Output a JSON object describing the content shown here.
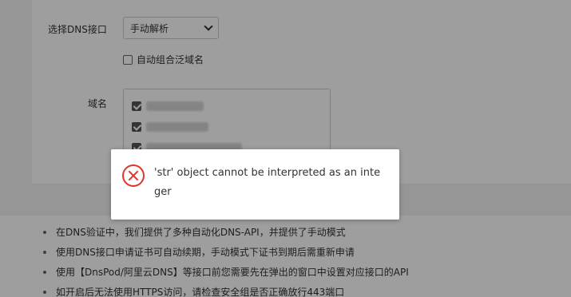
{
  "form": {
    "dns_label": "选择DNS接口",
    "dns_selected": "手动解析",
    "wildcard_label": "自动组合泛域名",
    "domain_label": "域名",
    "domains": [
      {
        "checked": true
      },
      {
        "checked": true
      },
      {
        "checked": true
      }
    ]
  },
  "tips": [
    "在DNS验证中，我们提供了多种自动化DNS-API，并提供了手动模式",
    "使用DNS接口申请证书可自动续期，手动模式下证书到期后需重新申请",
    "使用【DnsPod/阿里云DNS】等接口前您需要先在弹出的窗口中设置对应接口的API",
    "如开启后无法使用HTTPS访问，请检查安全组是否正确放行443端口"
  ],
  "dialog": {
    "message": "'str' object cannot be interpreted as an integer",
    "icon": "error-circle-icon",
    "icon_color": "#e2352b"
  }
}
